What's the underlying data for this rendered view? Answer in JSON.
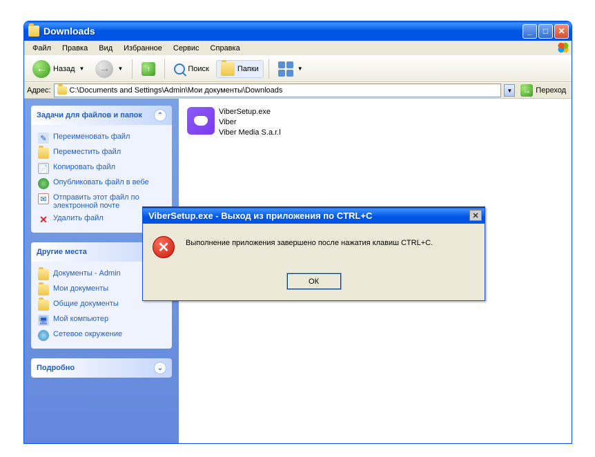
{
  "window": {
    "title": "Downloads"
  },
  "menu": {
    "file": "Файл",
    "edit": "Правка",
    "view": "Вид",
    "favorites": "Избранное",
    "tools": "Сервис",
    "help": "Справка"
  },
  "toolbar": {
    "back": "Назад",
    "search": "Поиск",
    "folders": "Папки"
  },
  "address": {
    "label": "Адрес:",
    "path": "C:\\Documents and Settings\\Admin\\Мои документы\\Downloads",
    "go": "Переход"
  },
  "panels": {
    "tasks": {
      "header": "Задачи для файлов и папок",
      "rename": "Переименовать файл",
      "move": "Переместить файл",
      "copy": "Копировать файл",
      "publish": "Опубликовать файл в вебе",
      "email": "Отправить этот файл по электронной почте",
      "delete": "Удалить файл"
    },
    "other": {
      "header": "Другие места",
      "docs_admin": "Документы - Admin",
      "my_docs": "Мои документы",
      "shared_docs": "Общие документы",
      "my_pc": "Мой компьютер",
      "network": "Сетевое окружение"
    },
    "details": {
      "header": "Подробно"
    }
  },
  "file": {
    "name": "ViberSetup.exe",
    "product": "Viber",
    "company": "Viber Media S.a.r.l"
  },
  "dialog": {
    "title": "ViberSetup.exe - Выход из приложения по CTRL+C",
    "message": "Выполнение приложения завершено после нажатия клавиш CTRL+C.",
    "ok": "ОК"
  }
}
